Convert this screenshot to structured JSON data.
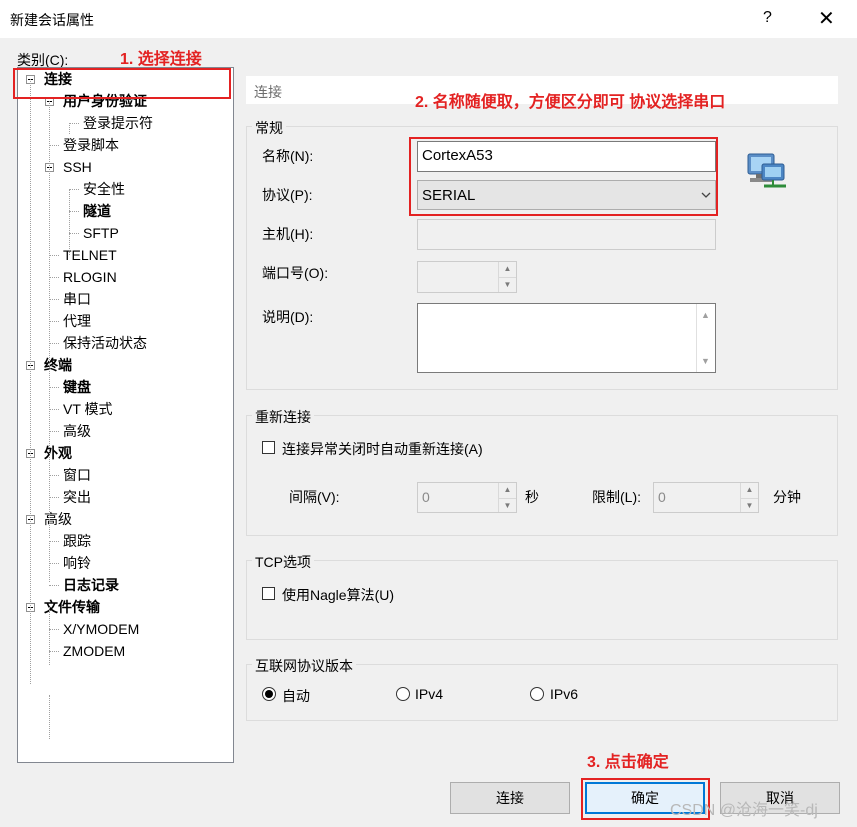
{
  "window": {
    "title": "新建会话属性",
    "help": "?",
    "close": "✕"
  },
  "category_label": "类别(C):",
  "tree": [
    {
      "label": "连接",
      "bold": true,
      "level": 0,
      "expander": true
    },
    {
      "label": "用户身份验证",
      "bold": true,
      "level": 1,
      "expander": true
    },
    {
      "label": "登录提示符",
      "bold": false,
      "level": 2,
      "expander": false
    },
    {
      "label": "登录脚本",
      "bold": false,
      "level": 1,
      "expander": false
    },
    {
      "label": "SSH",
      "bold": false,
      "level": 1,
      "expander": true
    },
    {
      "label": "安全性",
      "bold": false,
      "level": 2,
      "expander": false
    },
    {
      "label": "隧道",
      "bold": true,
      "level": 2,
      "expander": false
    },
    {
      "label": "SFTP",
      "bold": false,
      "level": 2,
      "expander": false
    },
    {
      "label": "TELNET",
      "bold": false,
      "level": 1,
      "expander": false
    },
    {
      "label": "RLOGIN",
      "bold": false,
      "level": 1,
      "expander": false
    },
    {
      "label": "串口",
      "bold": false,
      "level": 1,
      "expander": false
    },
    {
      "label": "代理",
      "bold": false,
      "level": 1,
      "expander": false
    },
    {
      "label": "保持活动状态",
      "bold": false,
      "level": 1,
      "expander": false
    },
    {
      "label": "终端",
      "bold": true,
      "level": 0,
      "expander": true
    },
    {
      "label": "键盘",
      "bold": true,
      "level": 1,
      "expander": false
    },
    {
      "label": "VT 模式",
      "bold": false,
      "level": 1,
      "expander": false
    },
    {
      "label": "高级",
      "bold": false,
      "level": 1,
      "expander": false
    },
    {
      "label": "外观",
      "bold": true,
      "level": 0,
      "expander": true
    },
    {
      "label": "窗口",
      "bold": false,
      "level": 1,
      "expander": false
    },
    {
      "label": "突出",
      "bold": false,
      "level": 1,
      "expander": false
    },
    {
      "label": "高级",
      "bold": false,
      "level": 0,
      "expander": true
    },
    {
      "label": "跟踪",
      "bold": false,
      "level": 1,
      "expander": false
    },
    {
      "label": "响铃",
      "bold": false,
      "level": 1,
      "expander": false
    },
    {
      "label": "日志记录",
      "bold": true,
      "level": 1,
      "expander": false
    },
    {
      "label": "文件传输",
      "bold": true,
      "level": 0,
      "expander": true
    },
    {
      "label": "X/YMODEM",
      "bold": false,
      "level": 1,
      "expander": false
    },
    {
      "label": "ZMODEM",
      "bold": false,
      "level": 1,
      "expander": false
    }
  ],
  "panel": {
    "header": "连接",
    "general": {
      "title": "常规",
      "name_label": "名称(N):",
      "name_value": "CortexA53",
      "protocol_label": "协议(P):",
      "protocol_value": "SERIAL",
      "host_label": "主机(H):",
      "host_value": "",
      "port_label": "端口号(O):",
      "port_value": "",
      "desc_label": "说明(D):",
      "desc_value": ""
    },
    "reconnect": {
      "title": "重新连接",
      "checkbox_label": "连接异常关闭时自动重新连接(A)",
      "interval_label": "间隔(V):",
      "interval_value": "0",
      "interval_unit": "秒",
      "limit_label": "限制(L):",
      "limit_value": "0",
      "limit_unit": "分钟"
    },
    "tcp": {
      "title": "TCP选项",
      "nagle_label": "使用Nagle算法(U)"
    },
    "ipver": {
      "title": "互联网协议版本",
      "options": [
        "自动",
        "IPv4",
        "IPv6"
      ],
      "selected": "自动"
    }
  },
  "buttons": {
    "connect": "连接",
    "ok": "确定",
    "cancel": "取消"
  },
  "annotations": {
    "step1": "1. 选择连接",
    "step2": "2. 名称随便取，方便区分即可  协议选择串口",
    "step3": "3. 点击确定",
    "color": "#e32222"
  },
  "watermark": "CSDN @沧海一笑-dj"
}
